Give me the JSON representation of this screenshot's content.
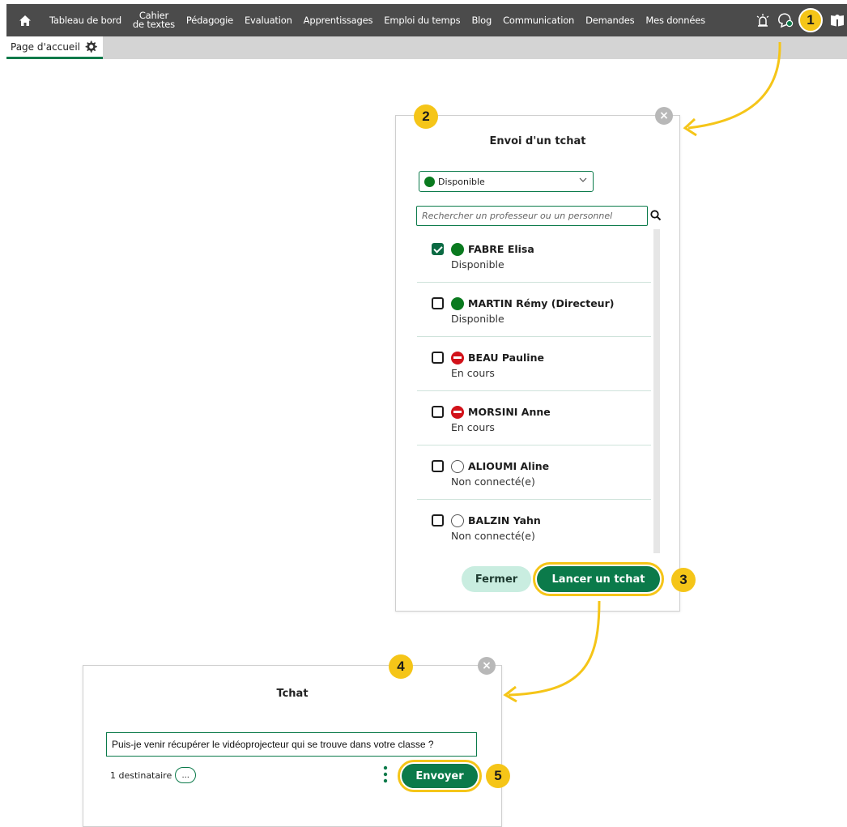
{
  "nav": {
    "items": [
      {
        "label": "Tableau de bord"
      },
      {
        "label_line1": "Cahier",
        "label_line2": "de textes"
      },
      {
        "label": "Pédagogie"
      },
      {
        "label": "Evaluation"
      },
      {
        "label": "Apprentissages"
      },
      {
        "label": "Emploi du temps"
      },
      {
        "label": "Blog"
      },
      {
        "label": "Communication"
      },
      {
        "label": "Demandes"
      },
      {
        "label": "Mes données"
      }
    ]
  },
  "subbar": {
    "home_tab": "Page d'accueil"
  },
  "callouts": [
    "1",
    "2",
    "3",
    "4",
    "5"
  ],
  "send_chat_modal": {
    "title": "Envoi d'un tchat",
    "status_selected": "Disponible",
    "search_placeholder": "Rechercher un professeur ou un personnel",
    "people": [
      {
        "name": "FABRE Elisa",
        "status": "Disponible",
        "state": "available",
        "checked": true
      },
      {
        "name": "MARTIN Rémy (Directeur)",
        "status": "Disponible",
        "state": "available",
        "checked": false
      },
      {
        "name": "BEAU Pauline",
        "status": "En cours",
        "state": "busy",
        "checked": false
      },
      {
        "name": "MORSINI Anne",
        "status": "En cours",
        "state": "busy",
        "checked": false
      },
      {
        "name": "ALIOUMI Aline",
        "status": "Non connecté(e)",
        "state": "offline",
        "checked": false
      },
      {
        "name": "BALZIN Yahn",
        "status": "Non connecté(e)",
        "state": "offline",
        "checked": false
      }
    ],
    "close_label": "Fermer",
    "launch_label": "Lancer un tchat"
  },
  "chat_modal": {
    "title": "Tchat",
    "message": "Puis-je venir récupérer le vidéoprojecteur qui se trouve dans votre classe ?",
    "recipients": "1 destinataire",
    "more_label": "...",
    "send_label": "Envoyer"
  },
  "colors": {
    "accent": "#0b7a4a",
    "highlight": "#f5c518",
    "topbar": "#4b4b4b",
    "available": "#0a7a1f",
    "busy": "#d2121a"
  }
}
